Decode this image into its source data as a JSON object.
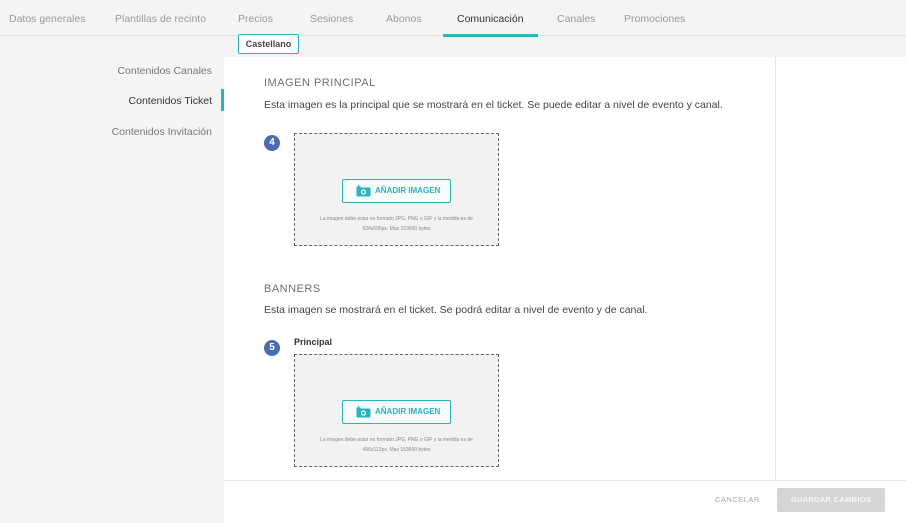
{
  "topnav": {
    "tabs": [
      {
        "label": "Datos generales",
        "active": false
      },
      {
        "label": "Plantillas de recinto",
        "active": false
      },
      {
        "label": "Precios",
        "active": false
      },
      {
        "label": "Sesiones",
        "active": false
      },
      {
        "label": "Abonos",
        "active": false
      },
      {
        "label": "Comunicación",
        "active": true
      },
      {
        "label": "Canales",
        "active": false
      },
      {
        "label": "Promociones",
        "active": false
      }
    ]
  },
  "sidebar": {
    "items": [
      {
        "label": "Contenidos Canales",
        "active": false
      },
      {
        "label": "Contenidos Ticket",
        "active": true
      },
      {
        "label": "Contenidos Invitación",
        "active": false
      }
    ]
  },
  "language_tab": "Castellano",
  "main_image": {
    "title": "IMAGEN PRINCIPAL",
    "description": "Esta imagen es la principal que se mostrará en el ticket. Se puede editar a nivel de evento y canal.",
    "step": "4",
    "button_label": "AÑADIR IMAGEN",
    "note_line1": "La imagen debe estar en formato JPG, PNG o GIF y la medida es de",
    "note_line2": "624x696px. Max 153600 bytes"
  },
  "banners": {
    "title": "BANNERS",
    "description": "Esta imagen se mostrará en el ticket. Se podrá editar a nivel de evento y de canal.",
    "step": "5",
    "sub_label": "Principal",
    "button_label": "AÑADIR IMAGEN",
    "note_line1": "La imagen debe estar en formato JPG, PNG o GIF y la medida es de",
    "note_line2": "456x112px. Max 153600 bytes"
  },
  "footer": {
    "cancel_label": "CANCELAR",
    "save_label": "GUARDAR CAMBIOS"
  },
  "colors": {
    "accent": "#2bb3c0",
    "step_badge": "#4b6bb0",
    "save_disabled": "#d5d5d5"
  },
  "icons": {
    "add_image": "camera-plus-icon"
  }
}
